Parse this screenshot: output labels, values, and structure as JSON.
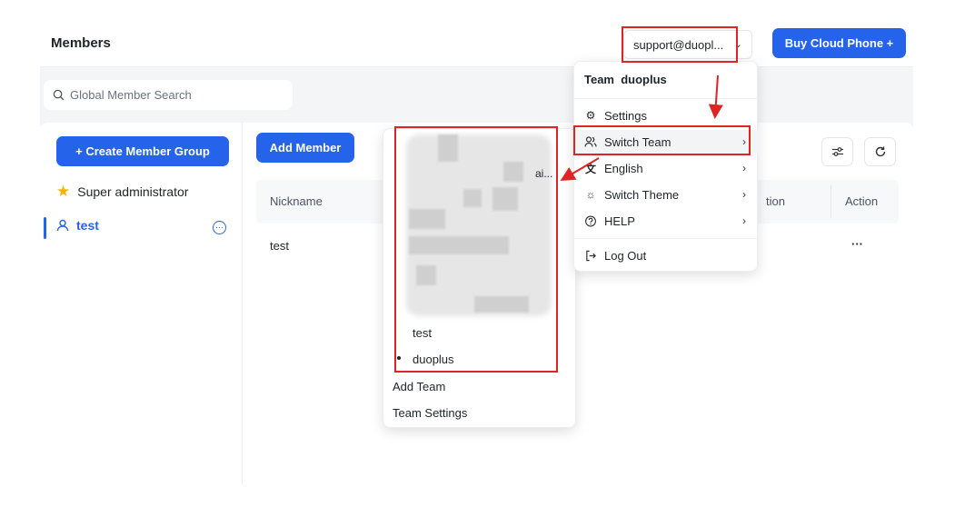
{
  "header": {
    "title": "Members",
    "account": "support@duopl...",
    "buy_button": "Buy Cloud Phone +"
  },
  "search": {
    "placeholder": "Global Member Search"
  },
  "sidebar": {
    "create_button": "+ Create Member Group",
    "groups": [
      {
        "label": "Super administrator",
        "icon": "star-icon"
      },
      {
        "label": "test",
        "icon": "user-icon"
      }
    ]
  },
  "main": {
    "add_member_button": "Add Member",
    "columns": [
      "Nickname",
      "tion",
      "Action"
    ],
    "rows": [
      {
        "nickname": "test",
        "action": "···"
      }
    ]
  },
  "user_menu": {
    "team_prefix": "Team",
    "team_name": "duoplus",
    "items": [
      {
        "label": "Settings",
        "icon": "gear-icon"
      },
      {
        "label": "Switch Team",
        "icon": "users-icon"
      },
      {
        "label": "English",
        "icon": "translate-icon"
      },
      {
        "label": "Switch Theme",
        "icon": "sun-icon"
      },
      {
        "label": "HELP",
        "icon": "help-icon"
      },
      {
        "label": "Log Out",
        "icon": "logout-icon"
      }
    ]
  },
  "team_menu": {
    "partial_fragment": "ai...",
    "teams": [
      "test",
      "duoplus"
    ],
    "add_team": "Add Team",
    "team_settings": "Team Settings"
  },
  "colors": {
    "accent": "#2563eb",
    "annotation": "#e02424"
  }
}
